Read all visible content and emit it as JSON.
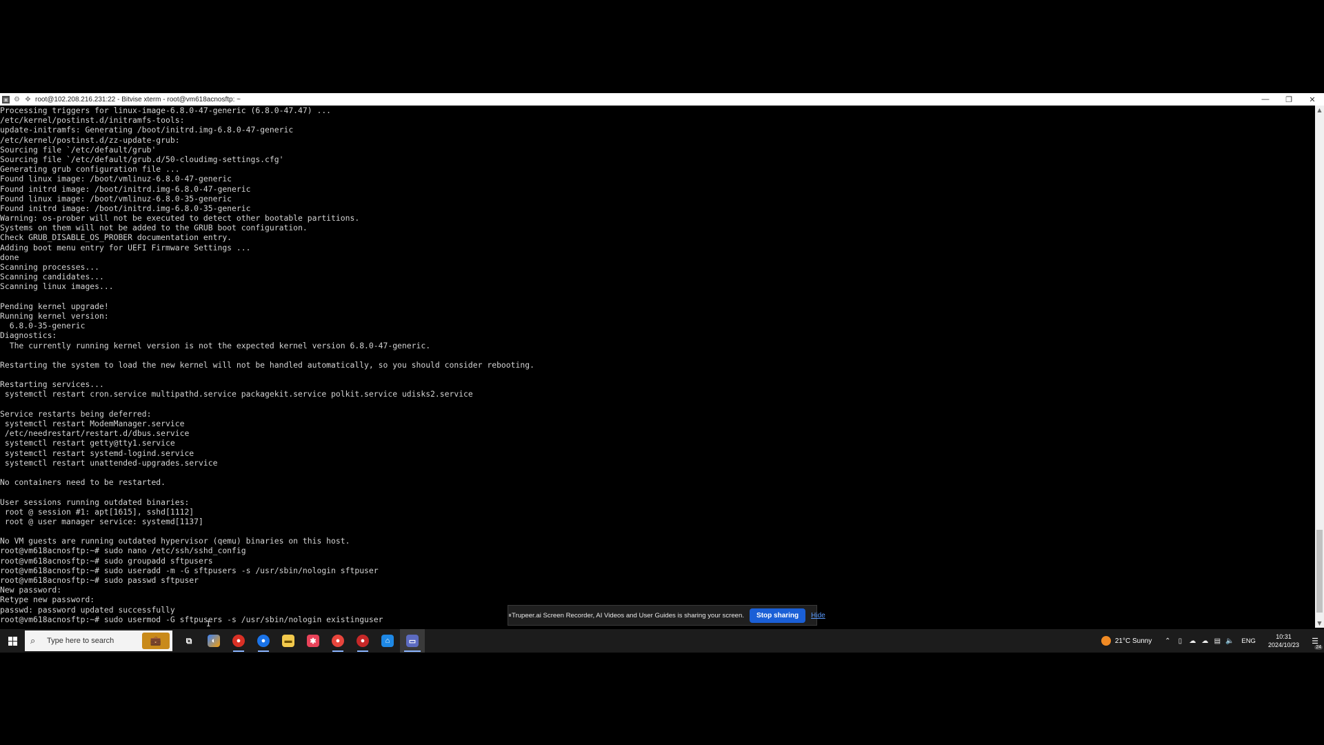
{
  "window": {
    "title": "root@102.208.216.231:22 - Bitvise xterm - root@vm618acnosftp: ~",
    "controls": {
      "minimize": "—",
      "restore": "❐",
      "close": "✕"
    }
  },
  "terminal": {
    "lines": [
      "Processing triggers for linux-image-6.8.0-47-generic (6.8.0-47.47) ...",
      "/etc/kernel/postinst.d/initramfs-tools:",
      "update-initramfs: Generating /boot/initrd.img-6.8.0-47-generic",
      "/etc/kernel/postinst.d/zz-update-grub:",
      "Sourcing file `/etc/default/grub'",
      "Sourcing file `/etc/default/grub.d/50-cloudimg-settings.cfg'",
      "Generating grub configuration file ...",
      "Found linux image: /boot/vmlinuz-6.8.0-47-generic",
      "Found initrd image: /boot/initrd.img-6.8.0-47-generic",
      "Found linux image: /boot/vmlinuz-6.8.0-35-generic",
      "Found initrd image: /boot/initrd.img-6.8.0-35-generic",
      "Warning: os-prober will not be executed to detect other bootable partitions.",
      "Systems on them will not be added to the GRUB boot configuration.",
      "Check GRUB_DISABLE_OS_PROBER documentation entry.",
      "Adding boot menu entry for UEFI Firmware Settings ...",
      "done",
      "Scanning processes...",
      "Scanning candidates...",
      "Scanning linux images...",
      "",
      "Pending kernel upgrade!",
      "Running kernel version:",
      "  6.8.0-35-generic",
      "Diagnostics:",
      "  The currently running kernel version is not the expected kernel version 6.8.0-47-generic.",
      "",
      "Restarting the system to load the new kernel will not be handled automatically, so you should consider rebooting.",
      "",
      "Restarting services...",
      " systemctl restart cron.service multipathd.service packagekit.service polkit.service udisks2.service",
      "",
      "Service restarts being deferred:",
      " systemctl restart ModemManager.service",
      " /etc/needrestart/restart.d/dbus.service",
      " systemctl restart getty@tty1.service",
      " systemctl restart systemd-logind.service",
      " systemctl restart unattended-upgrades.service",
      "",
      "No containers need to be restarted.",
      "",
      "User sessions running outdated binaries:",
      " root @ session #1: apt[1615], sshd[1112]",
      " root @ user manager service: systemd[1137]",
      "",
      "No VM guests are running outdated hypervisor (qemu) binaries on this host.",
      "root@vm618acnosftp:~# sudo nano /etc/ssh/sshd_config",
      "root@vm618acnosftp:~# sudo groupadd sftpusers",
      "root@vm618acnosftp:~# sudo useradd -m -G sftpusers -s /usr/sbin/nologin sftpuser",
      "root@vm618acnosftp:~# sudo passwd sftpuser",
      "New password:",
      "Retype new password:",
      "passwd: password updated successfully",
      "root@vm618acnosftp:~# sudo usermod -G sftpusers -s /usr/sbin/nologin existinguser"
    ]
  },
  "sharebar": {
    "message": "Trupeer.ai Screen Recorder, AI Videos and User Guides is sharing your screen.",
    "stop_label": "Stop sharing",
    "hide_label": "Hide"
  },
  "taskbar": {
    "search_placeholder": "Type here to search",
    "weather": "21°C  Sunny",
    "language": "ENG",
    "time": "10:31",
    "date": "2024/10/23",
    "notification_count": "24"
  }
}
